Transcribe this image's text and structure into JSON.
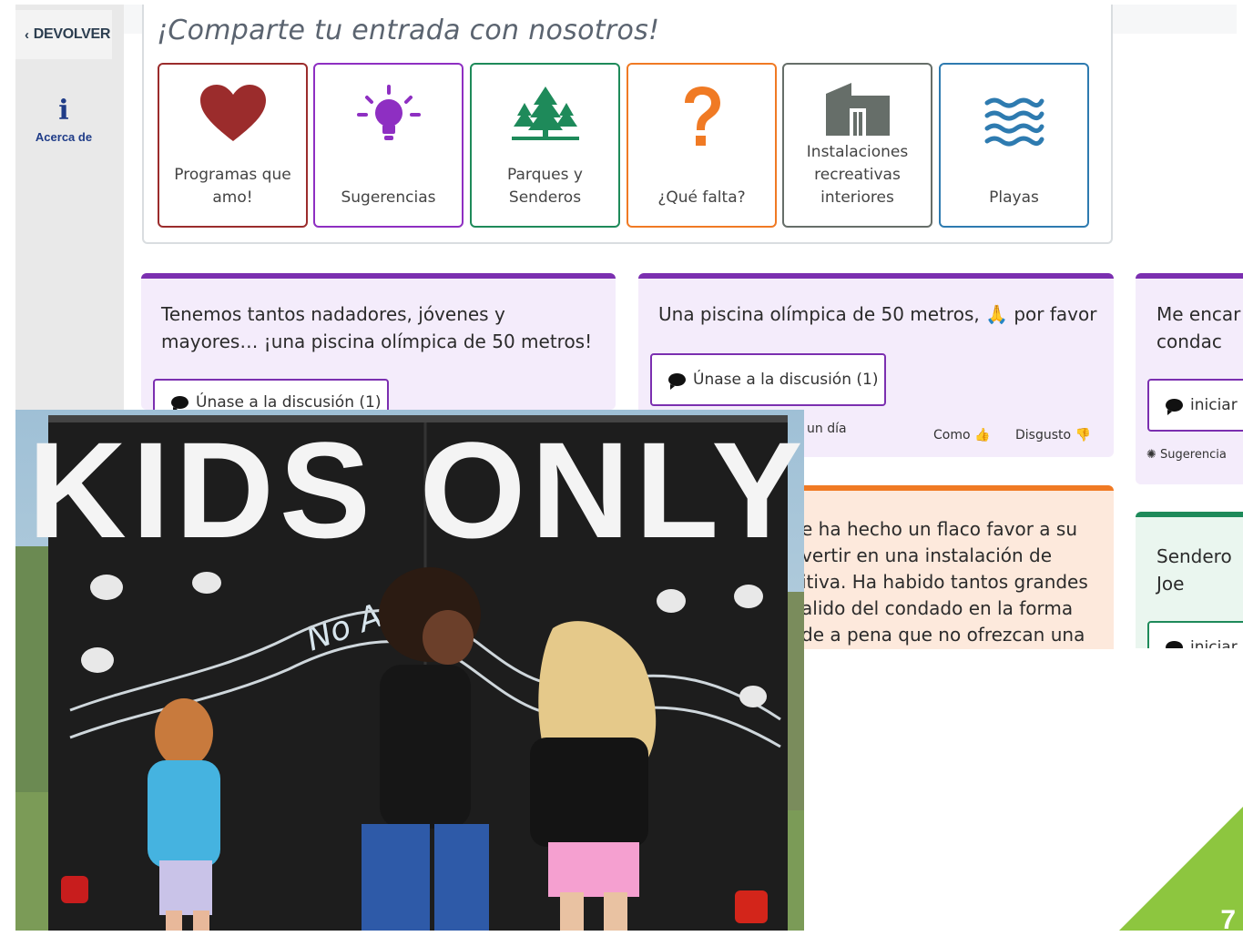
{
  "nav": {
    "back_label": "DEVOLVER",
    "about_label": "Acerca de"
  },
  "share": {
    "title": "¡Comparte tu entrada con nosotros!",
    "categories": [
      {
        "label": "Programas que amo!",
        "color": "#9b2c2c",
        "icon": "heart-icon"
      },
      {
        "label": "Sugerencias",
        "color": "#8e2fc2",
        "icon": "lightbulb-icon"
      },
      {
        "label": "Parques y Senderos",
        "color": "#1e8a5a",
        "icon": "trees-icon"
      },
      {
        "label": "¿Qué falta?",
        "color": "#f07a24",
        "icon": "question-icon"
      },
      {
        "label": "Instalaciones recreativas interiores",
        "color": "#666e69",
        "icon": "building-icon"
      },
      {
        "label": "Playas",
        "color": "#2e7bb0",
        "icon": "waves-icon"
      }
    ]
  },
  "cards": [
    {
      "text": "Tenemos tantos nadadores, jóvenes y mayores… ¡una piscina olímpica de 50 metros!",
      "button": "Únase a la discusión (1)"
    },
    {
      "text": "Una piscina olímpica de 50 metros, 🙏 por favor",
      "button": "Únase a la discusión (1)",
      "time": "un día",
      "like": "Como",
      "dislike": "Disgusto"
    },
    {
      "text": "Me encar el condac",
      "button": "iniciar",
      "tag": "Sugerencia"
    },
    {
      "text": "e ha hecho un flaco favor a su vertir en una instalación de itiva. Ha habido tantos grandes alido del condado en la forma de a pena que no ofrezcan una"
    },
    {
      "text": "Sendero Joe",
      "button": "iniciar"
    }
  ],
  "photo": {
    "sign": "KIDS ONLY",
    "chalk_text": "No Ad To"
  },
  "slide": {
    "page_number": "7"
  },
  "colors": {
    "purple": "#7b2fb0",
    "orange": "#f07a24",
    "green": "#1e8a5a",
    "corner": "#8dc63f"
  }
}
